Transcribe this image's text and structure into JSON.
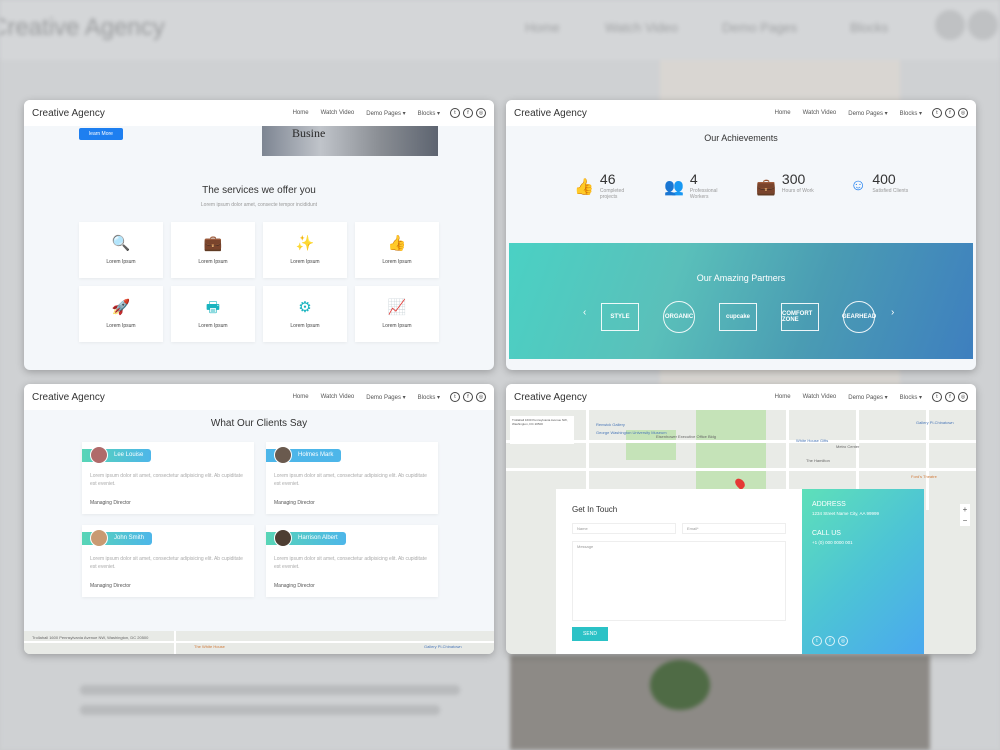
{
  "background": {
    "brand": "Creative Agency",
    "nav": [
      "Home",
      "Watch Video",
      "Demo Pages",
      "Blocks"
    ]
  },
  "navbar": {
    "brand": "Creative Agency",
    "items": [
      "Home",
      "Watch Video",
      "Demo Pages ▾",
      "Blocks ▾"
    ],
    "socials": [
      "twitter-icon",
      "facebook-icon",
      "instagram-icon"
    ]
  },
  "services": {
    "learn_more": "learn More",
    "news_text": "Busine",
    "title": "The services we offer you",
    "subtitle": "Lorem ipsum dolor amet, consecte tempor incididunt",
    "items": [
      {
        "icon": "search-icon",
        "glyph": "🔍",
        "label": "Lorem Ipsum"
      },
      {
        "icon": "briefcase-icon",
        "glyph": "💼",
        "label": "Lorem Ipsum"
      },
      {
        "icon": "magic-wand-icon",
        "glyph": "✨",
        "label": "Lorem Ipsum"
      },
      {
        "icon": "thumbs-up-icon",
        "glyph": "👍",
        "label": "Lorem Ipsum"
      },
      {
        "icon": "rocket-icon",
        "glyph": "🚀",
        "label": "Lorem Ipsum"
      },
      {
        "icon": "printer-icon",
        "glyph": "🖶",
        "label": "Lorem Ipsum"
      },
      {
        "icon": "gears-icon",
        "glyph": "⚙",
        "label": "Lorem Ipsum"
      },
      {
        "icon": "line-chart-icon",
        "glyph": "📈",
        "label": "Lorem Ipsum"
      }
    ]
  },
  "achievements": {
    "title": "Our Achievements",
    "items": [
      {
        "icon": "thumbs-up-icon",
        "glyph": "👍",
        "number": "46",
        "label": "Completed projects"
      },
      {
        "icon": "users-icon",
        "glyph": "👥",
        "number": "4",
        "label": "Professional Workers"
      },
      {
        "icon": "briefcase-clock-icon",
        "glyph": "💼",
        "number": "300",
        "label": "Hours of Work"
      },
      {
        "icon": "smile-icon",
        "glyph": "☺",
        "number": "400",
        "label": "Satisfied Clients"
      }
    ]
  },
  "partners": {
    "title": "Our Amazing Partners",
    "logos": [
      "STYLE",
      "ORGANIC",
      "cupcake",
      "COMFORT ZONE",
      "GEARHEAD"
    ]
  },
  "clients": {
    "title": "What Our Clients Say",
    "items": [
      {
        "name": "Lee Louise",
        "text": "Lorem ipsum dolor sit amet, consectetur adipisicing elit. Ab cupiditate est eveniet.",
        "role": "Managing Director"
      },
      {
        "name": "Holmes Mark",
        "text": "Lorem ipsum dolor sit amet, consectetur adipisicing elit. Ab cupiditate est eveniet.",
        "role": "Managing Director"
      },
      {
        "name": "John Smith",
        "text": "Lorem ipsum dolor sit amet, consectetur adipisicing elit. Ab cupiditate est eveniet.",
        "role": "Managing Director"
      },
      {
        "name": "Harrison Albert",
        "text": "Lorem ipsum dolor sit amet, consectetur adipisicing elit. Ab cupiditate est eveniet.",
        "role": "Managing Director"
      }
    ]
  },
  "map": {
    "info": "Trollahall 1600 Pennsylvania Avenue NW, Washington, DC 20500",
    "places": [
      "Renwick Gallery",
      "George Washington University Museum",
      "Eisenhower Executive Office Bldg",
      "The White House",
      "White House Gifts",
      "Ford's Theatre",
      "Gallery Pl-Chinatown",
      "Metro Center",
      "The Hamilton"
    ]
  },
  "contact": {
    "title": "Get In Touch",
    "name_placeholder": "Name",
    "email_placeholder": "Email*",
    "message_placeholder": "Message",
    "send": "SEND",
    "address_heading": "ADDRESS",
    "address": "1234 Street Name City, AA 99999",
    "call_heading": "CALL US",
    "phone": "+1 (0) 000 0000 001"
  }
}
